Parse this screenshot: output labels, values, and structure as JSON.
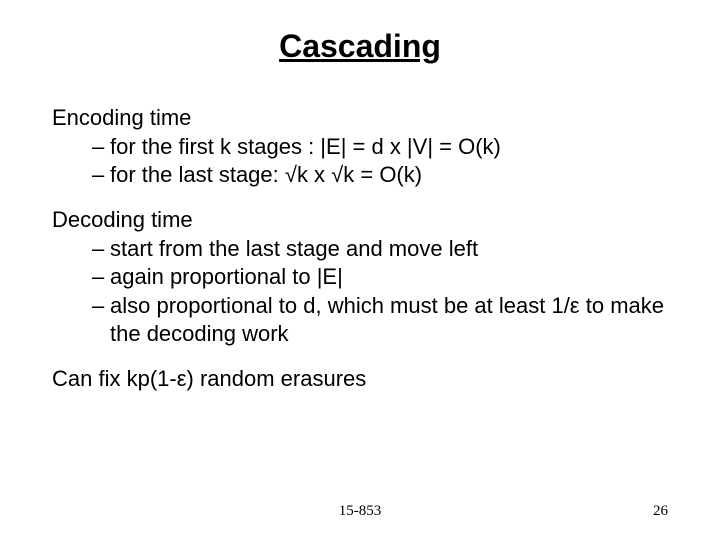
{
  "title": "Cascading",
  "sections": [
    {
      "heading": "Encoding time",
      "bullets": [
        "for the first k stages : |E| = d x |V| = O(k)",
        "for the last stage: √k x √k = O(k)"
      ]
    },
    {
      "heading": "Decoding time",
      "bullets": [
        "start from the last stage and move left",
        "again proportional to |E|",
        "also proportional to d, which must be at least 1/ε to make the decoding work"
      ]
    }
  ],
  "closing": "Can fix kp(1-ε) random erasures",
  "footer": {
    "course": "15-853",
    "page": "26"
  }
}
